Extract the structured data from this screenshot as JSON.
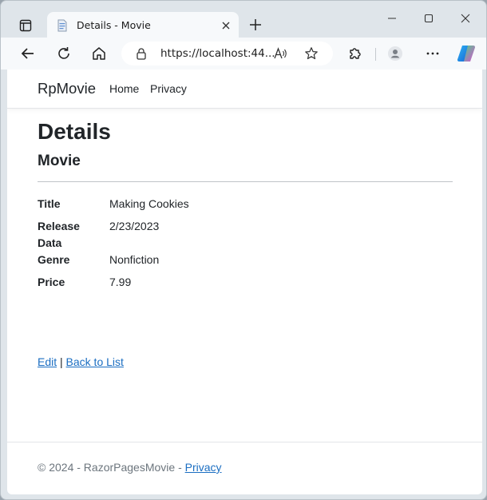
{
  "browser": {
    "tab_title": "Details - Movie",
    "url": "https://localhost:44...",
    "icons": {
      "sidebar": "sidebar-icon",
      "favicon": "page-icon",
      "tab_close": "close-icon",
      "new_tab": "plus-icon",
      "minimize": "minimize-icon",
      "maximize": "maximize-icon",
      "close": "close-icon",
      "back": "back-arrow-icon",
      "refresh": "refresh-icon",
      "home": "home-icon",
      "lock": "lock-icon",
      "read_aloud": "read-aloud-icon",
      "favorite": "star-icon",
      "extensions": "puzzle-icon",
      "profile": "profile-icon",
      "more": "more-icon",
      "copilot": "copilot-icon"
    }
  },
  "navbar": {
    "brand": "RpMovie",
    "links": [
      "Home",
      "Privacy"
    ]
  },
  "page": {
    "title": "Details",
    "subtitle": "Movie",
    "fields": [
      {
        "label": "Title",
        "value": "Making Cookies"
      },
      {
        "label": "Release Data",
        "value": "2/23/2023"
      },
      {
        "label": "Genre",
        "value": "Nonfiction"
      },
      {
        "label": "Price",
        "value": "7.99"
      }
    ],
    "actions": {
      "edit": "Edit",
      "separator": "|",
      "back": "Back to List"
    }
  },
  "footer": {
    "text": "© 2024 - RazorPagesMovie - ",
    "privacy": "Privacy"
  },
  "colors": {
    "link": "#1b6ec2",
    "text": "#212529",
    "muted": "#6c757d",
    "chrome": "#dfe5ea"
  }
}
